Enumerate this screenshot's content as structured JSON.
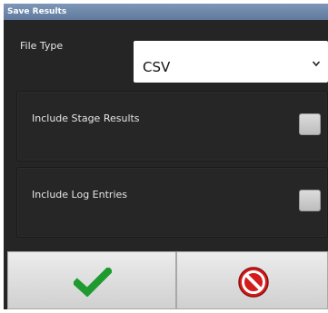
{
  "dialog": {
    "title": "Save Results",
    "file_type": {
      "label": "File Type",
      "selected_value": "CSV"
    },
    "options": [
      {
        "label": "Include Stage Results",
        "checked": false
      },
      {
        "label": "Include Log Entries",
        "checked": false
      }
    ],
    "buttons": {
      "ok_icon": "checkmark-icon",
      "cancel_icon": "no-entry-icon"
    }
  },
  "colors": {
    "title_bar": "#6f88ab",
    "background": "#252525",
    "check_green": "#1f9a2e",
    "cancel_red": "#d41c1c"
  }
}
